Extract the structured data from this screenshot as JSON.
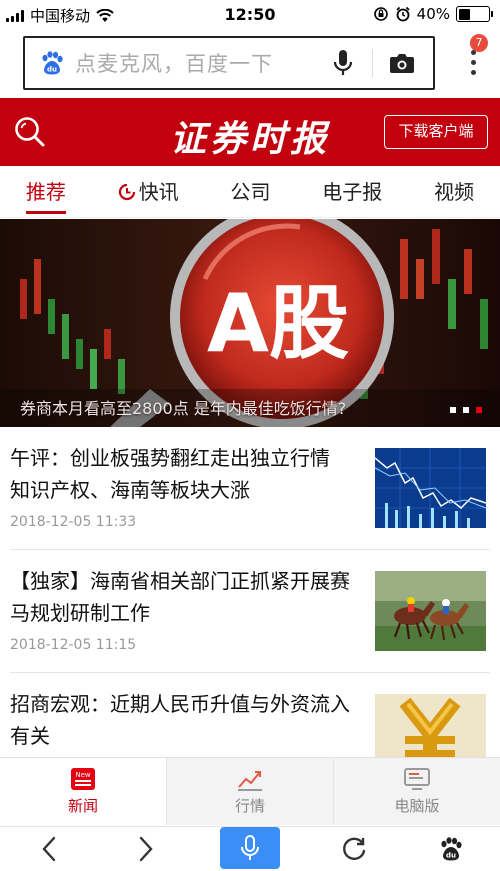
{
  "status_bar": {
    "carrier": "中国移动",
    "time": "12:50",
    "battery": "40%",
    "battery_level": 0.4
  },
  "browser": {
    "search_placeholder": "点麦克风，百度一下",
    "badge_count": "7"
  },
  "header": {
    "logo": "证券时报",
    "download_button": "下载客户端"
  },
  "tabs": [
    {
      "label": "推荐",
      "active": true
    },
    {
      "label": "快讯",
      "active": false,
      "icon": "clock-icon"
    },
    {
      "label": "公司",
      "active": false
    },
    {
      "label": "电子报",
      "active": false
    },
    {
      "label": "视频",
      "active": false
    }
  ],
  "banner": {
    "headline_text": "A股",
    "caption": "券商本月看高至2800点 是年内最佳吃饭行情?",
    "slide_count": 3,
    "active_slide": 3
  },
  "news": [
    {
      "title": "午评：创业板强势翻红走出独立行情 知识产权、海南等板块大涨",
      "date": "2018-12-05 11:33",
      "thumb": "stock-chart-image"
    },
    {
      "title": "【独家】海南省相关部门正抓紧开展赛马规划研制工作",
      "date": "2018-12-05 11:15",
      "thumb": "horse-racing-image"
    },
    {
      "title": "招商宏观：近期人民币升值与外资流入有关",
      "date": "",
      "thumb": "yuan-symbol-image"
    }
  ],
  "app_nav": [
    {
      "label": "新闻",
      "icon": "news-icon",
      "active": true,
      "icon_badge": "New"
    },
    {
      "label": "行情",
      "icon": "market-trend-icon",
      "active": false
    },
    {
      "label": "电脑版",
      "icon": "desktop-icon",
      "active": false
    }
  ],
  "toolbar": {
    "items": [
      "back-icon",
      "forward-icon",
      "voice-search-icon",
      "refresh-icon",
      "baidu-paw-icon"
    ]
  },
  "colors": {
    "brand_red": "#c3000d",
    "voice_blue": "#3a8ef6",
    "baidu_blue": "#2f6fe6"
  }
}
